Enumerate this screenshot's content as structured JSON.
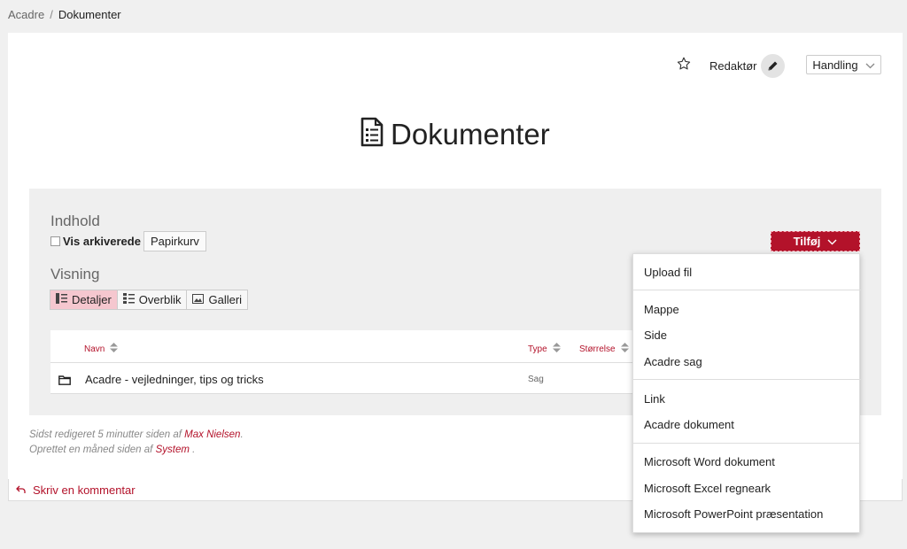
{
  "breadcrumb": {
    "root": "Acadre",
    "separator": "/",
    "current": "Dokumenter"
  },
  "topbar": {
    "editor_label": "Redaktør",
    "action_label": "Handling"
  },
  "page": {
    "title": "Dokumenter"
  },
  "content": {
    "heading": "Indhold",
    "show_archived_label": "Vis arkiverede",
    "trash_label": "Papirkurv",
    "add_label": "Tilføj"
  },
  "view": {
    "heading": "Visning",
    "options": [
      {
        "label": "Detaljer",
        "active": true
      },
      {
        "label": "Overblik",
        "active": false
      },
      {
        "label": "Galleri",
        "active": false
      }
    ]
  },
  "table": {
    "columns": [
      "Navn",
      "Type",
      "Størrelse"
    ],
    "rows": [
      {
        "name": "Acadre - vejledninger, tips og tricks",
        "type": "Sag"
      }
    ]
  },
  "meta": {
    "edited_prefix": "Sidst redigeret 5 minutter siden af",
    "edited_by": "Max Nielsen",
    "edited_suffix": ".",
    "created_prefix": "Oprettet en måned siden af",
    "created_by": "System",
    "created_suffix": "."
  },
  "comment": {
    "label": "Skriv en kommentar"
  },
  "add_menu": {
    "items": [
      "Upload fil",
      "Mappe",
      "Side",
      "Acadre sag",
      "Link",
      "Acadre dokument",
      "Microsoft Word dokument",
      "Microsoft Excel regneark",
      "Microsoft PowerPoint præsentation"
    ]
  },
  "colors": {
    "accent": "#b3122a",
    "active_view": "#f5c7cf",
    "panel": "#efefef",
    "background": "#f0f0f0"
  }
}
